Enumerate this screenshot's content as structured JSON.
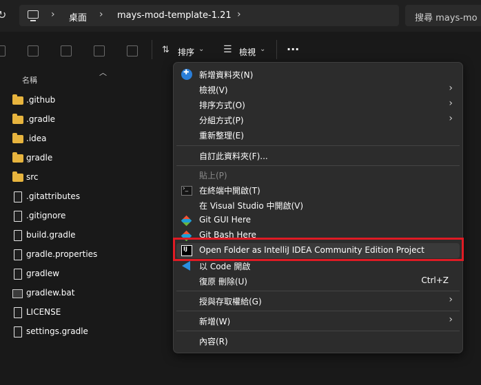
{
  "address_bar": {
    "path": [
      "桌面",
      "mays-mod-template-1.21"
    ],
    "search_placeholder": "搜尋 mays-mo"
  },
  "toolbar": {
    "sort_label": "排序",
    "view_label": "檢視",
    "more_label": "···"
  },
  "file_list": {
    "column_header": "名稱",
    "items": [
      {
        "name": ".github",
        "type": "folder"
      },
      {
        "name": ".gradle",
        "type": "folder"
      },
      {
        "name": ".idea",
        "type": "folder"
      },
      {
        "name": "gradle",
        "type": "folder"
      },
      {
        "name": "src",
        "type": "folder"
      },
      {
        "name": ".gitattributes",
        "type": "file"
      },
      {
        "name": ".gitignore",
        "type": "file"
      },
      {
        "name": "build.gradle",
        "type": "file"
      },
      {
        "name": "gradle.properties",
        "type": "file"
      },
      {
        "name": "gradlew",
        "type": "file"
      },
      {
        "name": "gradlew.bat",
        "type": "batch"
      },
      {
        "name": "LICENSE",
        "type": "file"
      },
      {
        "name": "settings.gradle",
        "type": "file"
      }
    ]
  },
  "context_menu": {
    "items": [
      {
        "label": "新增資料夾(N)"
      },
      {
        "label": "檢視(V)"
      },
      {
        "label": "排序方式(O)"
      },
      {
        "label": "分組方式(P)"
      },
      {
        "label": "重新整理(E)"
      },
      {
        "label": "自訂此資料夾(F)..."
      },
      {
        "label": "貼上(P)"
      },
      {
        "label": "在終端中開啟(T)"
      },
      {
        "label": "在 Visual Studio 中開啟(V)"
      },
      {
        "label": "Git GUI Here"
      },
      {
        "label": "Git Bash Here"
      },
      {
        "label": "Open Folder as IntelliJ IDEA Community Edition Project"
      },
      {
        "label": "以 Code 開啟"
      },
      {
        "label": "復原 刪除(U)",
        "shortcut": "Ctrl+Z"
      },
      {
        "label": "授與存取權給(G)"
      },
      {
        "label": "新增(W)"
      },
      {
        "label": "內容(R)"
      }
    ]
  },
  "colors": {
    "highlight_border": "#e01b24",
    "folder": "#e7b43e",
    "menu_bg": "#2c2c2c"
  }
}
